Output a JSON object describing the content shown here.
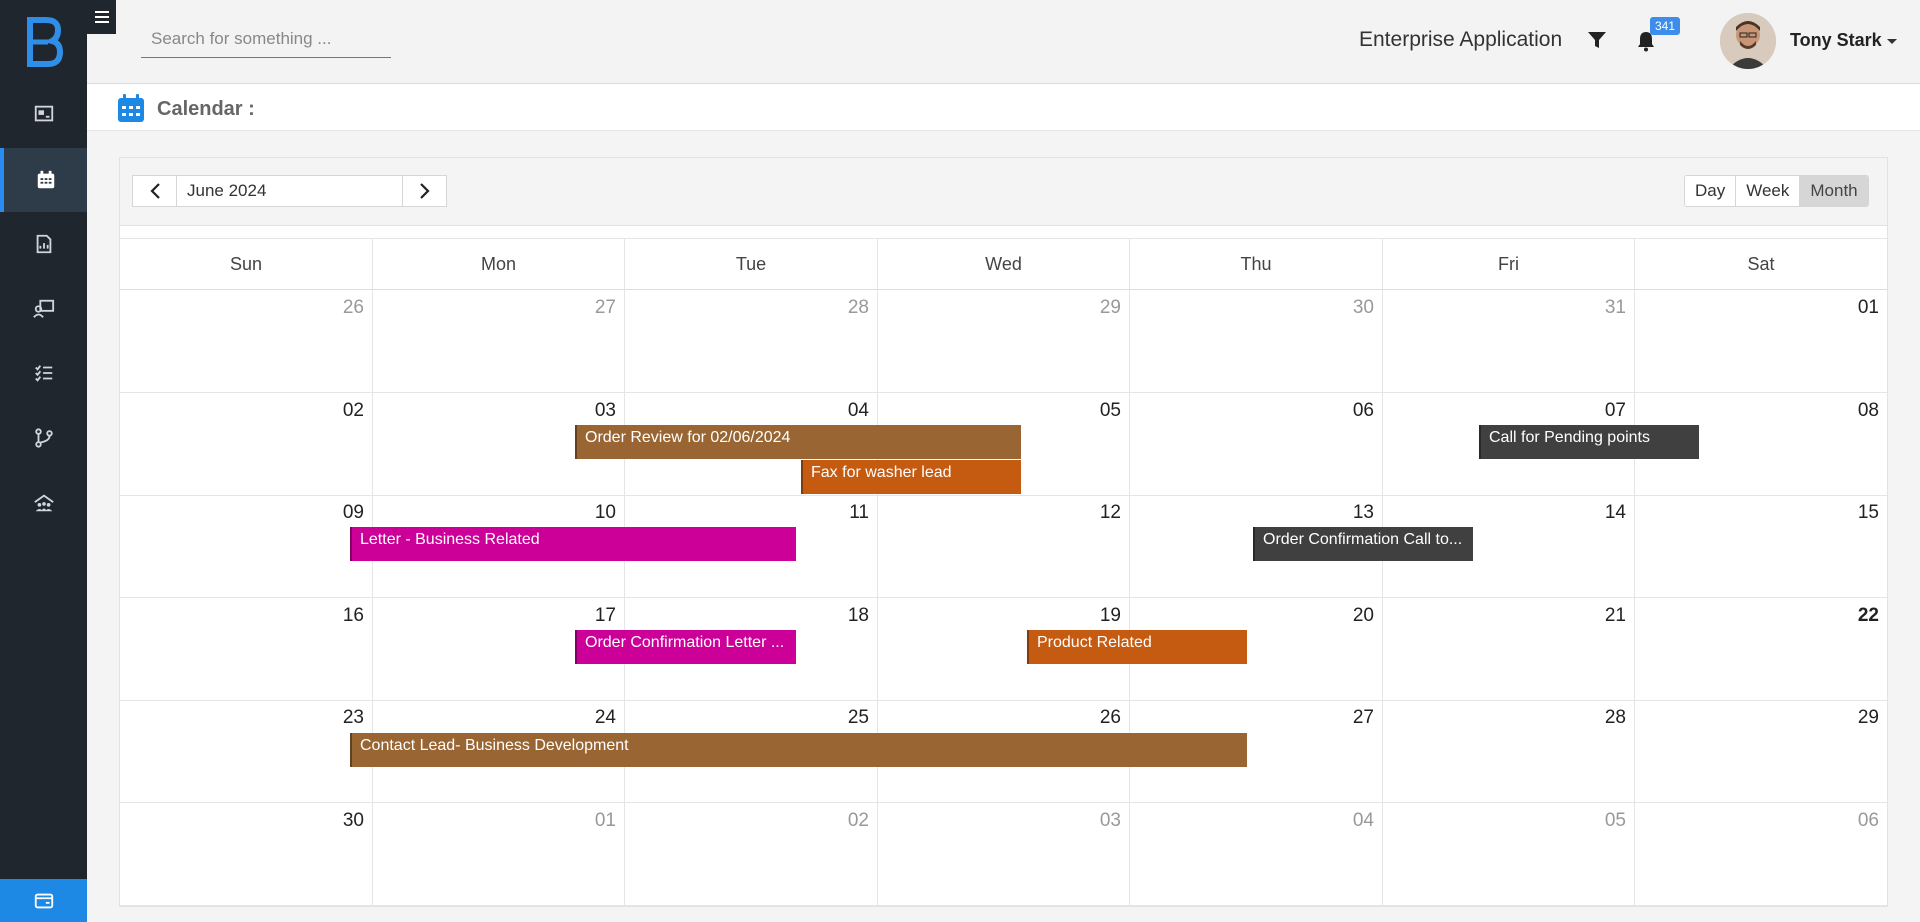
{
  "header": {
    "search_placeholder": "Search for something ...",
    "app_title": "Enterprise Application",
    "notification_count": "341",
    "user_name": "Tony Stark"
  },
  "page": {
    "title": "Calendar :"
  },
  "calendar": {
    "current_month": "June 2024",
    "views": [
      "Day",
      "Week",
      "Month"
    ],
    "active_view": "Month",
    "weekdays": [
      "Sun",
      "Mon",
      "Tue",
      "Wed",
      "Thu",
      "Fri",
      "Sat"
    ],
    "weeks": [
      [
        "26",
        "27",
        "28",
        "29",
        "30",
        "31",
        "01"
      ],
      [
        "02",
        "03",
        "04",
        "05",
        "06",
        "07",
        "08"
      ],
      [
        "09",
        "10",
        "11",
        "12",
        "13",
        "14",
        "15"
      ],
      [
        "16",
        "17",
        "18",
        "19",
        "20",
        "21",
        "22"
      ],
      [
        "23",
        "24",
        "25",
        "26",
        "27",
        "28",
        "29"
      ],
      [
        "30",
        "01",
        "02",
        "03",
        "04",
        "05",
        "06"
      ]
    ],
    "today": "22",
    "events": [
      {
        "title": "Order Review for 02/06/2024",
        "color": "#996633"
      },
      {
        "title": "Fax for washer lead",
        "color": "#c55a11"
      },
      {
        "title": "Call for Pending points",
        "color": "#404040"
      },
      {
        "title": "Letter - Business Related",
        "color": "#cc0099"
      },
      {
        "title": "Order Confirmation Call to...",
        "color": "#404040"
      },
      {
        "title": "Order Confirmation Letter ...",
        "color": "#cc0099"
      },
      {
        "title": "Product Related",
        "color": "#c55a11"
      },
      {
        "title": "Contact Lead- Business Development",
        "color": "#996633"
      }
    ]
  },
  "colors": {
    "accent": "#1e88e5",
    "sidebar": "#20262d"
  }
}
